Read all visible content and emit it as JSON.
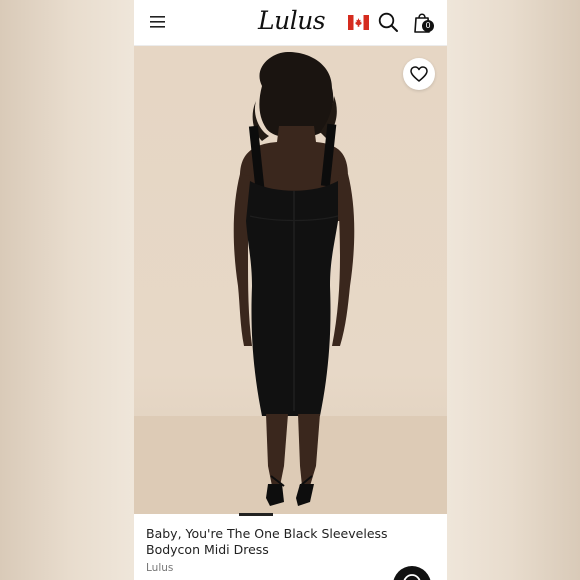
{
  "header": {
    "logo_text": "Lulus",
    "bag_count": "0",
    "menu_icon": "hamburger-menu-icon",
    "flag_icon": "canada-flag-icon",
    "search_icon": "search-icon",
    "bag_icon": "shopping-bag-icon"
  },
  "product": {
    "image_alt": "Back view of model wearing black sleeveless bodycon midi dress",
    "title": "Baby, You're The One Black Sleeveless Bodycon Midi Dress",
    "brand": "Lulus",
    "favorite_icon": "heart-outline-icon"
  },
  "carousel": {
    "active_index": 1
  },
  "colors": {
    "accent": "#111111",
    "flag_red": "#d52b1e",
    "background": "#efe6da"
  }
}
